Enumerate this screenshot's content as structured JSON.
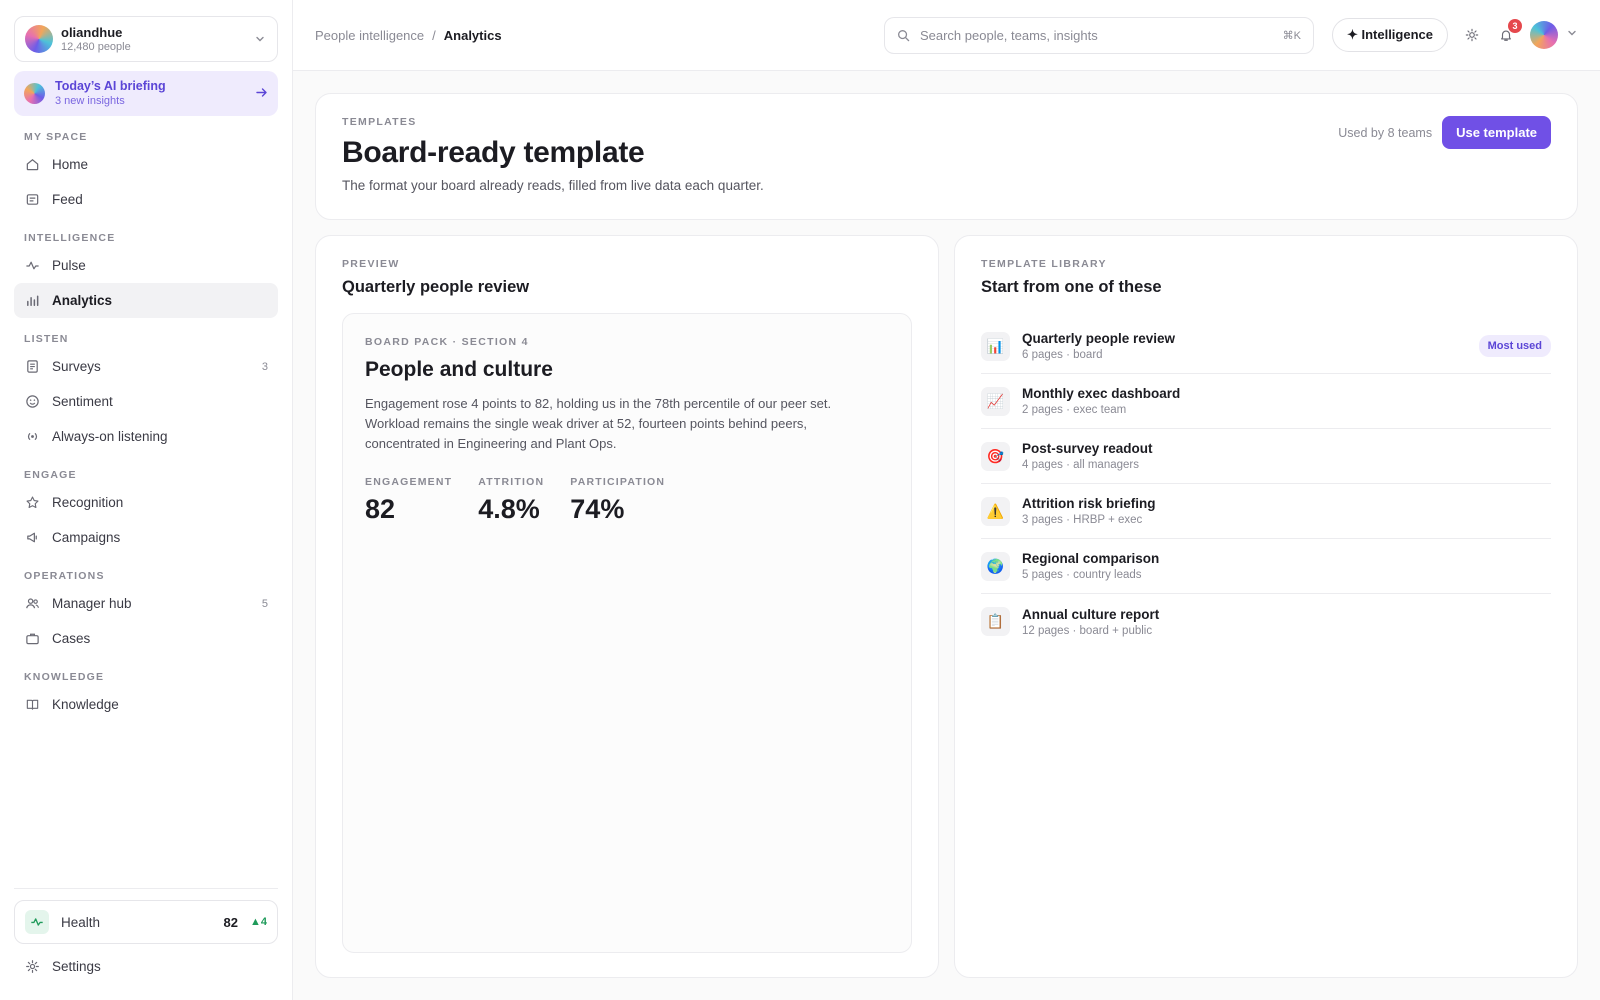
{
  "org": {
    "name": "oliandhue",
    "subtitle": "12,480 people"
  },
  "briefing": {
    "title": "Today’s AI briefing",
    "subtitle": "3 new insights"
  },
  "sidebar": {
    "sections": [
      {
        "label": "MY SPACE",
        "items": [
          {
            "label": "Home",
            "icon": "home-icon"
          },
          {
            "label": "Feed",
            "icon": "feed-icon"
          }
        ]
      },
      {
        "label": "INTELLIGENCE",
        "items": [
          {
            "label": "Pulse",
            "icon": "pulse-icon"
          },
          {
            "label": "Analytics",
            "icon": "bar-chart-icon",
            "active": true
          }
        ]
      },
      {
        "label": "LISTEN",
        "items": [
          {
            "label": "Surveys",
            "icon": "survey-icon",
            "badge": "3"
          },
          {
            "label": "Sentiment",
            "icon": "smile-icon"
          },
          {
            "label": "Always-on listening",
            "icon": "broadcast-icon"
          }
        ]
      },
      {
        "label": "ENGAGE",
        "items": [
          {
            "label": "Recognition",
            "icon": "star-icon"
          },
          {
            "label": "Campaigns",
            "icon": "megaphone-icon"
          }
        ]
      },
      {
        "label": "OPERATIONS",
        "items": [
          {
            "label": "Manager hub",
            "icon": "users-icon",
            "badge": "5"
          },
          {
            "label": "Cases",
            "icon": "briefcase-icon"
          }
        ]
      },
      {
        "label": "KNOWLEDGE",
        "items": [
          {
            "label": "Knowledge",
            "icon": "book-icon"
          }
        ]
      }
    ],
    "health": {
      "label": "Health",
      "value": "82",
      "delta": "▲4"
    },
    "settings_label": "Settings"
  },
  "topbar": {
    "breadcrumb": {
      "parent": "People intelligence",
      "separator": "/",
      "current": "Analytics"
    },
    "search_placeholder": "Search people, teams, insights",
    "search_shortcut": "⌘K",
    "intelligence_label": "✦ Intelligence",
    "notification_count": "3"
  },
  "hero": {
    "eyebrow": "TEMPLATES",
    "title": "Board-ready template",
    "description": "The format your board already reads, filled from live data each quarter.",
    "used_by": "Used by 8 teams",
    "cta": "Use template"
  },
  "preview": {
    "eyebrow": "PREVIEW",
    "title": "Quarterly people review",
    "box": {
      "eyebrow": "BOARD PACK · SECTION 4",
      "title": "People and culture",
      "body": "Engagement rose 4 points to 82, holding us in the 78th percentile of our peer set. Workload remains the single weak driver at 52, fourteen points behind peers, concentrated in Engineering and Plant Ops.",
      "metrics": [
        {
          "label": "ENGAGEMENT",
          "value": "82"
        },
        {
          "label": "ATTRITION",
          "value": "4.8%"
        },
        {
          "label": "PARTICIPATION",
          "value": "74%"
        }
      ]
    }
  },
  "library": {
    "eyebrow": "TEMPLATE LIBRARY",
    "title": "Start from one of these",
    "items": [
      {
        "name": "Quarterly people review",
        "meta": "6 pages · board",
        "icon": "📊",
        "tag": "Most used"
      },
      {
        "name": "Monthly exec dashboard",
        "meta": "2 pages · exec team",
        "icon": "📈"
      },
      {
        "name": "Post-survey readout",
        "meta": "4 pages · all managers",
        "icon": "🎯"
      },
      {
        "name": "Attrition risk briefing",
        "meta": "3 pages · HRBP + exec",
        "icon": "⚠️"
      },
      {
        "name": "Regional comparison",
        "meta": "5 pages · country leads",
        "icon": "🌍"
      },
      {
        "name": "Annual culture report",
        "meta": "12 pages · board + public",
        "icon": "📋"
      }
    ]
  },
  "colors": {
    "accent": "#7050e6",
    "accent_soft": "#efebfd",
    "positive": "#1f9a5a",
    "alert": "#e5484d"
  }
}
